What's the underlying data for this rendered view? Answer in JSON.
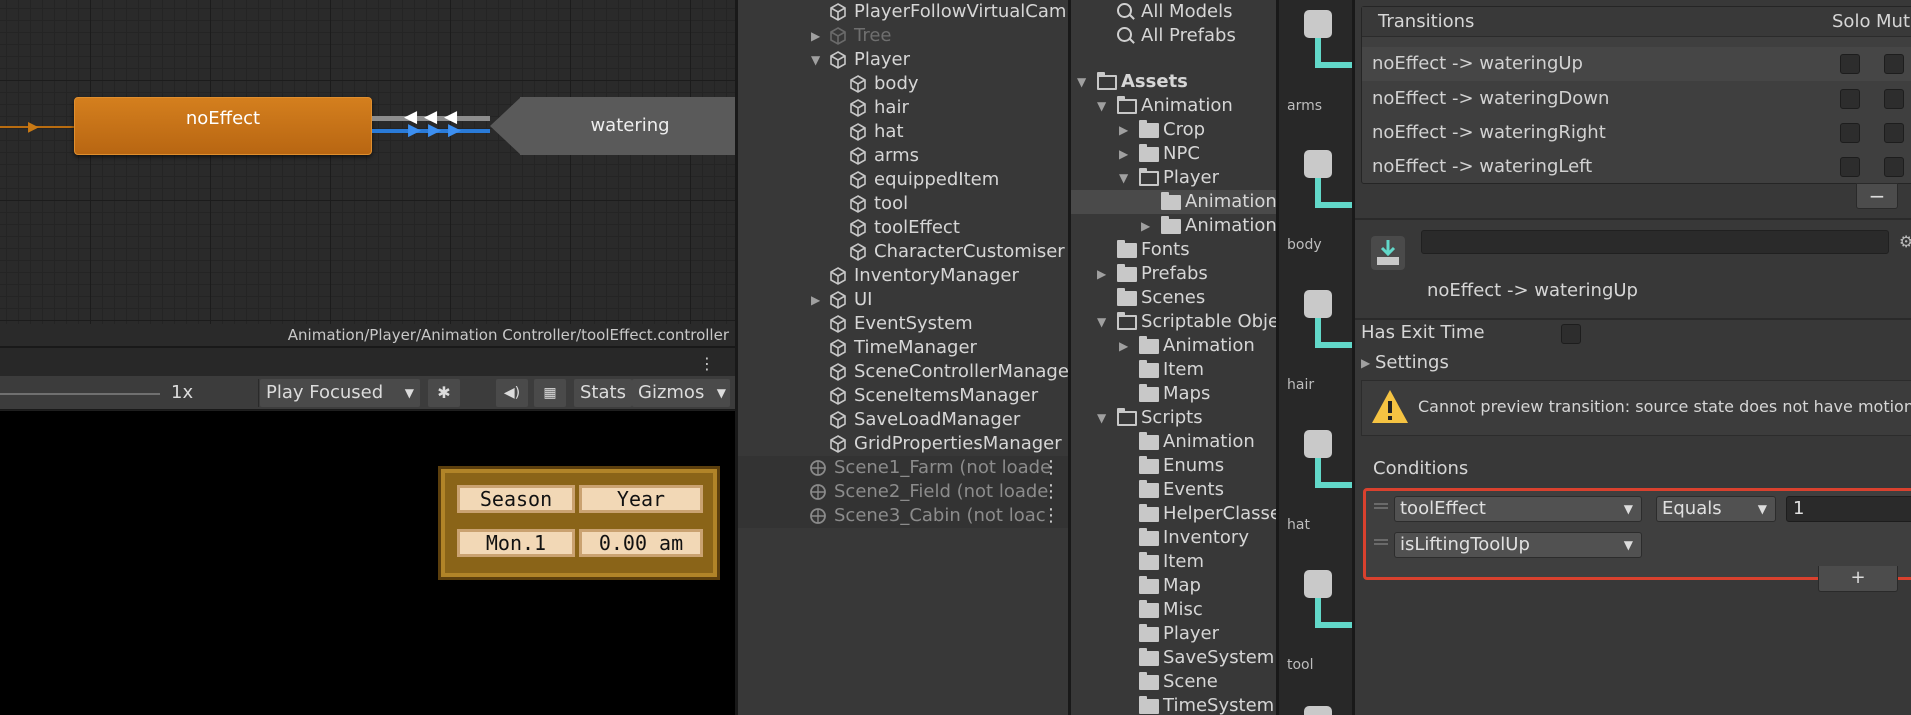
{
  "animator": {
    "state_left": "noEffect",
    "state_right": "watering",
    "path": "Animation/Player/Animation Controller/toolEffect.controller"
  },
  "game": {
    "scale": "1x",
    "play_mode": "Play Focused",
    "stats": "Stats",
    "gizmos": "Gizmos",
    "hud": {
      "season": "Season",
      "year": "Year",
      "day": "Mon.1",
      "time": "0.00 am"
    }
  },
  "hierarchy": {
    "rows": [
      {
        "label": "PlayerFollowVirtualCam"
      },
      {
        "label": "Tree"
      },
      {
        "label": "Player"
      },
      {
        "label": "body"
      },
      {
        "label": "hair"
      },
      {
        "label": "hat"
      },
      {
        "label": "arms"
      },
      {
        "label": "equippedItem"
      },
      {
        "label": "tool"
      },
      {
        "label": "toolEffect"
      },
      {
        "label": "CharacterCustomiser"
      },
      {
        "label": "InventoryManager"
      },
      {
        "label": "UI"
      },
      {
        "label": "EventSystem"
      },
      {
        "label": "TimeManager"
      },
      {
        "label": "SceneControllerManage"
      },
      {
        "label": "SceneItemsManager"
      },
      {
        "label": "SaveLoadManager"
      },
      {
        "label": "GridPropertiesManager"
      }
    ],
    "scenes": [
      {
        "label": "Scene1_Farm (not loade"
      },
      {
        "label": "Scene2_Field (not loade"
      },
      {
        "label": "Scene3_Cabin (not loac"
      }
    ]
  },
  "project": {
    "search_models": "All Models",
    "search_prefabs": "All Prefabs",
    "rows": [
      {
        "label": "Assets"
      },
      {
        "label": "Animation"
      },
      {
        "label": "Crop"
      },
      {
        "label": "NPC"
      },
      {
        "label": "Player"
      },
      {
        "label": "Animation"
      },
      {
        "label": "Animations"
      },
      {
        "label": "Fonts"
      },
      {
        "label": "Prefabs"
      },
      {
        "label": "Scenes"
      },
      {
        "label": "Scriptable Obje"
      },
      {
        "label": "Animation"
      },
      {
        "label": "Item"
      },
      {
        "label": "Maps"
      },
      {
        "label": "Scripts"
      },
      {
        "label": "Animation"
      },
      {
        "label": "Enums"
      },
      {
        "label": "Events"
      },
      {
        "label": "HelperClasse"
      },
      {
        "label": "Inventory"
      },
      {
        "label": "Item"
      },
      {
        "label": "Map"
      },
      {
        "label": "Misc"
      },
      {
        "label": "Player"
      },
      {
        "label": "SaveSystem"
      },
      {
        "label": "Scene"
      },
      {
        "label": "TimeSystem"
      }
    ]
  },
  "strip": {
    "labels": [
      "arms",
      "body",
      "hair",
      "hat",
      "tool"
    ]
  },
  "inspector": {
    "transitions_title": "Transitions",
    "solo": "Solo",
    "mute": "Mute",
    "transitions": [
      {
        "label": "noEffect -> wateringUp"
      },
      {
        "label": "noEffect -> wateringDown"
      },
      {
        "label": "noEffect -> wateringRight"
      },
      {
        "label": "noEffect -> wateringLeft"
      }
    ],
    "minus": "−",
    "selected_transition": "noEffect -> wateringUp",
    "has_exit_time": "Has Exit Time",
    "settings": "Settings",
    "warning": "Cannot preview transition: source state does not have motion",
    "conditions_title": "Conditions",
    "conditions": [
      {
        "param": "toolEffect",
        "op": "Equals",
        "value": "1"
      },
      {
        "param": "isLiftingToolUp"
      }
    ],
    "plus": "+"
  },
  "colors": {
    "state_orange": "#c8741a",
    "transition_blue": "#3d8ff0",
    "highlight_red": "#d9412e",
    "teal": "#62d8c9"
  }
}
